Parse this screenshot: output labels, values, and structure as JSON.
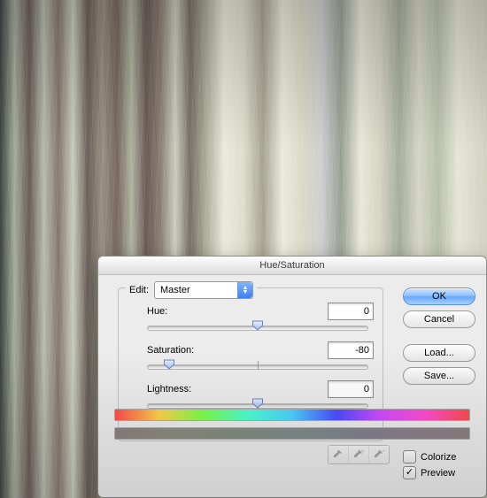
{
  "dialog": {
    "title": "Hue/Saturation",
    "edit_label": "Edit:",
    "edit_value": "Master",
    "hue": {
      "label": "Hue:",
      "value": "0",
      "pos_pct": 50
    },
    "saturation": {
      "label": "Saturation:",
      "value": "-80",
      "pos_pct": 10
    },
    "lightness": {
      "label": "Lightness:",
      "value": "0",
      "pos_pct": 50
    },
    "buttons": {
      "ok": "OK",
      "cancel": "Cancel",
      "load": "Load...",
      "save": "Save..."
    },
    "colorize": {
      "label": "Colorize",
      "checked": false
    },
    "preview": {
      "label": "Preview",
      "checked": true
    }
  }
}
